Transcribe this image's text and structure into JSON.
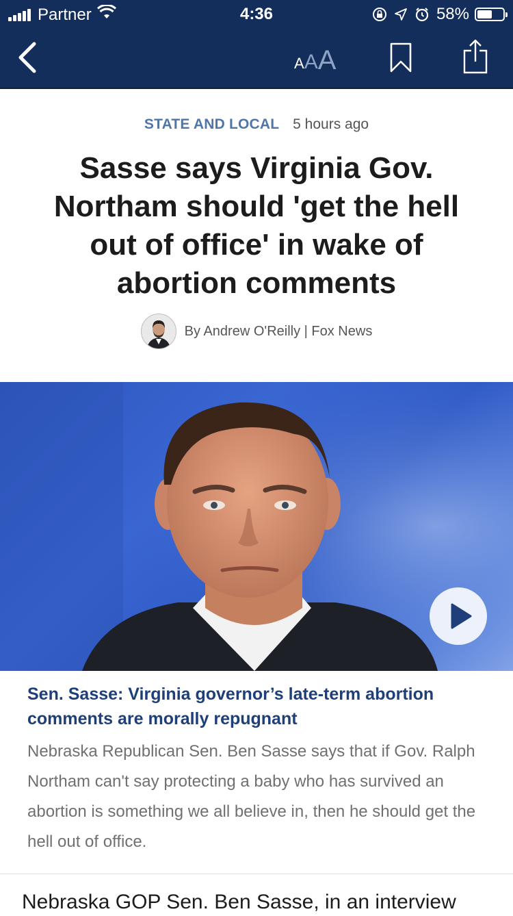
{
  "status_bar": {
    "carrier": "Partner",
    "time": "4:36",
    "battery_percent": "58%",
    "battery_level": 0.58,
    "icons": [
      "signal-icon",
      "wifi-icon",
      "orientation-lock-icon",
      "location-icon",
      "alarm-icon",
      "battery-icon"
    ]
  },
  "nav": {
    "textsize_small": "A",
    "textsize_medium": "A",
    "textsize_large": "A",
    "icons": [
      "back-chevron-icon",
      "bookmark-icon",
      "share-icon"
    ]
  },
  "article": {
    "category": "STATE AND LOCAL",
    "time_ago": "5 hours ago",
    "headline": "Sasse says Virginia Gov. Northam should 'get the hell out of office' in wake of abortion comments",
    "byline": "By Andrew O'Reilly | Fox News"
  },
  "video": {
    "caption_title": "Sen. Sasse: Virginia governor’s late-term abortion comments are morally repugnant",
    "caption_text": "Nebraska Republican Sen. Ben Sasse says that if Gov. Ralph Northam can't say protecting a baby who has survived an abortion is something we all believe in, then he should get the hell out of office."
  },
  "body": {
    "first_line": "Nebraska GOP Sen. Ben Sasse, in an interview"
  },
  "colors": {
    "nav_background": "#142e5b",
    "category": "#4f76a8",
    "caption_title": "#1e3f78",
    "image_blue": "#3a66d2"
  }
}
